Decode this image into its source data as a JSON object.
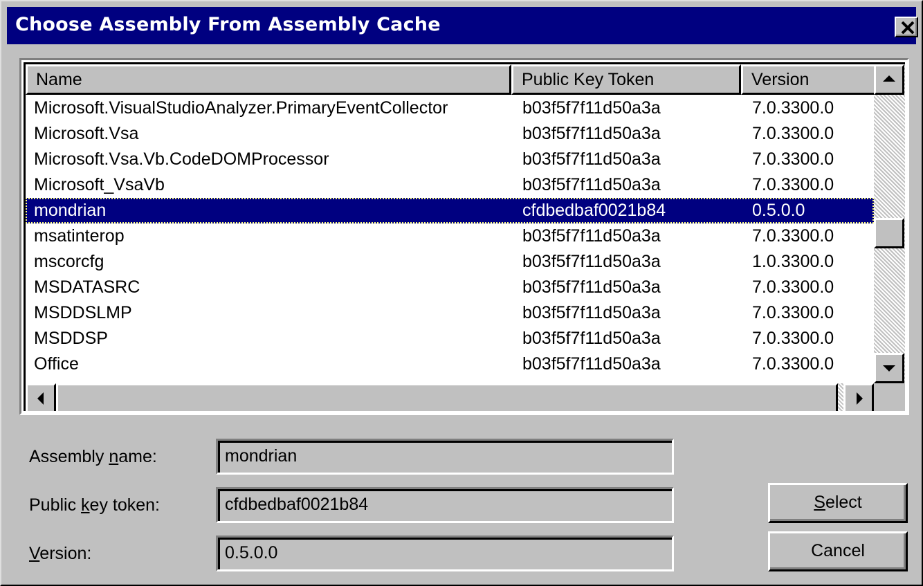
{
  "window": {
    "title": "Choose Assembly From Assembly Cache"
  },
  "list": {
    "columns": [
      "Name",
      "Public Key Token",
      "Version"
    ],
    "rows": [
      {
        "name": "Microsoft.VisualStudioAnalyzer.PrimaryEventCollector",
        "token": "b03f5f7f11d50a3a",
        "version": "7.0.3300.0"
      },
      {
        "name": "Microsoft.Vsa",
        "token": "b03f5f7f11d50a3a",
        "version": "7.0.3300.0"
      },
      {
        "name": "Microsoft.Vsa.Vb.CodeDOMProcessor",
        "token": "b03f5f7f11d50a3a",
        "version": "7.0.3300.0"
      },
      {
        "name": "Microsoft_VsaVb",
        "token": "b03f5f7f11d50a3a",
        "version": "7.0.3300.0"
      },
      {
        "name": "mondrian",
        "token": "cfdbedbaf0021b84",
        "version": "0.5.0.0"
      },
      {
        "name": "msatinterop",
        "token": "b03f5f7f11d50a3a",
        "version": "7.0.3300.0"
      },
      {
        "name": "mscorcfg",
        "token": "b03f5f7f11d50a3a",
        "version": "1.0.3300.0"
      },
      {
        "name": "MSDATASRC",
        "token": "b03f5f7f11d50a3a",
        "version": "7.0.3300.0"
      },
      {
        "name": "MSDDSLMP",
        "token": "b03f5f7f11d50a3a",
        "version": "7.0.3300.0"
      },
      {
        "name": "MSDDSP",
        "token": "b03f5f7f11d50a3a",
        "version": "7.0.3300.0"
      },
      {
        "name": "Office",
        "token": "b03f5f7f11d50a3a",
        "version": "7.0.3300.0"
      }
    ],
    "selected_row": "mondrian"
  },
  "details": {
    "assembly_name_label": "Assembly name:",
    "assembly_name_label_mnemonic": "n",
    "assembly_name_value": "mondrian",
    "public_key_label": "Public key token:",
    "public_key_label_mnemonic": "k",
    "public_key_value": "cfdbedbaf0021b84",
    "version_label": "Version:",
    "version_label_mnemonic": "V",
    "version_value": "0.5.0.0"
  },
  "buttons": {
    "select": "Select",
    "select_mnemonic": "S",
    "cancel": "Cancel"
  },
  "icons": [
    "close-icon",
    "scroll-up-arrow-icon",
    "scroll-down-arrow-icon",
    "scroll-left-arrow-icon",
    "scroll-right-arrow-icon"
  ],
  "colors": {
    "titlebar": "#000080",
    "selection": "#000080",
    "face": "#c0c0c0"
  }
}
